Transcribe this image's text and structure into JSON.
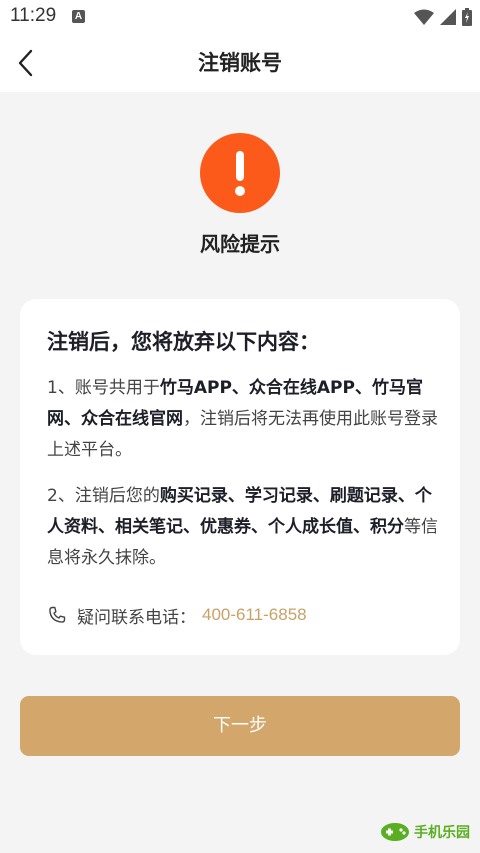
{
  "status_bar": {
    "time": "11:29",
    "notification_icon": "a-icon"
  },
  "header": {
    "title": "注销账号",
    "back_icon": "chevron-left-icon"
  },
  "warning": {
    "icon": "exclamation-icon",
    "icon_color": "#fb5a1a",
    "title": "风险提示"
  },
  "card": {
    "heading": "注销后，您将放弃以下内容：",
    "paragraph_1": {
      "prefix": "1、账号共用于",
      "platforms": "竹马APP、众合在线APP、竹马官网、众合在线官网",
      "suffix": "，注销后将无法再使用此账号登录上述平台。"
    },
    "paragraph_2": {
      "prefix": "2、注销后您的",
      "items": "购买记录、学习记录、刷题记录、个人资料、相关笔记、优惠券、个人成长值、积分",
      "suffix": "等信息将永久抹除。"
    },
    "contact": {
      "icon": "phone-icon",
      "label": "疑问联系电话：",
      "phone": "400-611-6858"
    }
  },
  "next_button": {
    "label": "下一步",
    "color": "#d3a66b"
  },
  "watermark": {
    "text": "手机乐园"
  },
  "colors": {
    "accent": "#d3a66b",
    "phone_text": "#c8a266",
    "background": "#f4f4f4"
  }
}
